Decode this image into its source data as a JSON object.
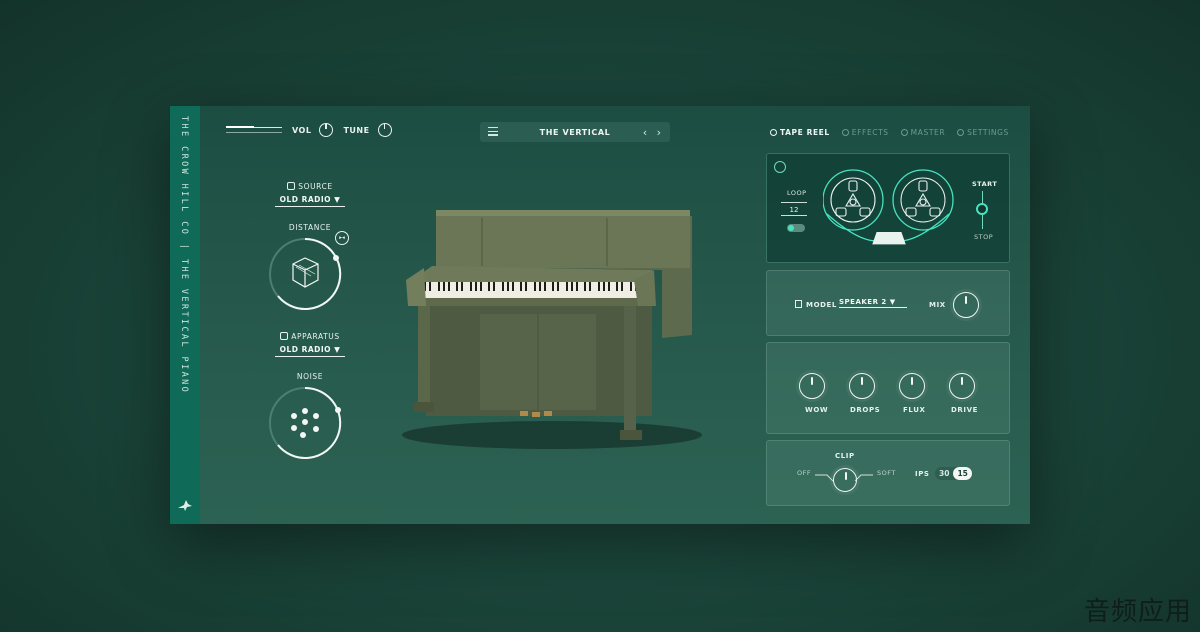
{
  "sidebar": {
    "title": "THE CROW HILL CO | THE VERTICAL PIANO",
    "logo_icon": "crow-icon"
  },
  "top": {
    "vol_label": "VOL",
    "tune_label": "TUNE",
    "vol_level": 0.5,
    "preset_name": "THE VERTICAL",
    "preset_arrows": "‹ ›"
  },
  "tabs": [
    {
      "label": "TAPE REEL",
      "active": true
    },
    {
      "label": "EFFECTS",
      "active": false
    },
    {
      "label": "MASTER",
      "active": false
    },
    {
      "label": "SETTINGS",
      "active": false
    }
  ],
  "left": {
    "source_label": "SOURCE",
    "source_value": "OLD RADIO ▼",
    "distance_label": "DISTANCE",
    "apparatus_label": "APPARATUS",
    "apparatus_value": "OLD RADIO ▼",
    "noise_label": "NOISE",
    "distance_badge": "▸◂"
  },
  "tape": {
    "loop_label": "LOOP",
    "loop_value": "12",
    "start_label": "START",
    "stop_label": "STOP",
    "power_icon": "power-icon"
  },
  "model": {
    "model_label": "MODEL",
    "model_value": "SPEAKER 2 ▼",
    "mix_label": "MIX"
  },
  "mods": [
    {
      "label": "WOW"
    },
    {
      "label": "DROPS"
    },
    {
      "label": "FLUX"
    },
    {
      "label": "DRIVE"
    }
  ],
  "clip": {
    "clip_label": "CLIP",
    "off_label": "OFF",
    "soft_label": "SOFT",
    "ips_label": "IPS",
    "ips_options": [
      "30",
      "15"
    ],
    "ips_selected": "15"
  },
  "watermark": "音频应用",
  "colors": {
    "accent": "#47e3c0",
    "sidebar": "#0f6a58",
    "panel_bg": "#25584b"
  }
}
